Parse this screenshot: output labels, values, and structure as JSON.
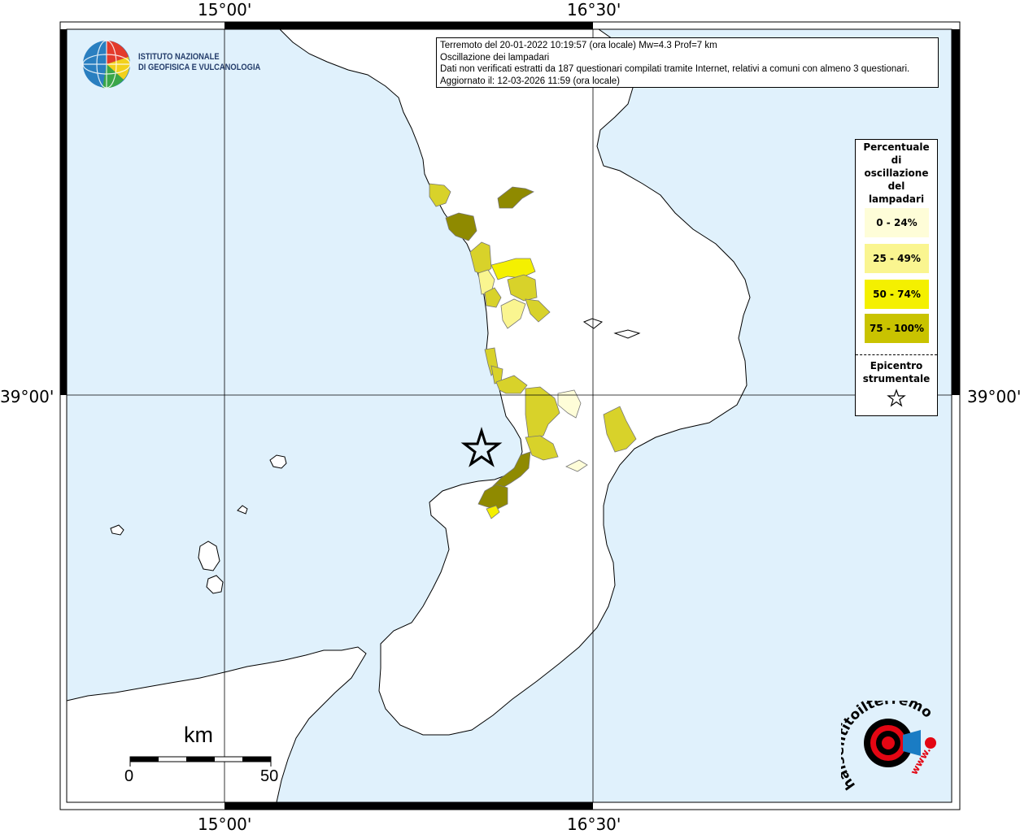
{
  "map": {
    "coords": {
      "lon_left": "15°00'",
      "lon_right": "16°30'",
      "lat": "39°00'"
    },
    "colors": {
      "sea": "#e0f1fc",
      "land": "#ffffff",
      "class_0_24": "#fefdd8",
      "class_25_49": "#faf590",
      "class_50_74": "#d8d22a",
      "class_75_100": "#8f8a00"
    }
  },
  "info": {
    "line1": "Terremoto del 20-01-2022 10:19:57 (ora locale) Mw=4.3 Prof=7 km",
    "line2": "Oscillazione dei lampadari",
    "line3": "Dati non verificati estratti da 187 questionari compilati tramite Internet, relativi a comuni con almeno 3 questionari.",
    "line4": "Aggiornato il: 12-03-2026 11:59 (ora locale)"
  },
  "legend": {
    "title": [
      "Percentuale",
      "di",
      "oscillazione",
      "del",
      "lampadari"
    ],
    "items": [
      {
        "label": "0 - 24%",
        "color": "#fefdd8"
      },
      {
        "label": "25 - 49%",
        "color": "#faf590"
      },
      {
        "label": "50 - 74%",
        "color": "#f4f000"
      },
      {
        "label": "75 - 100%",
        "color": "#c9c300"
      }
    ],
    "epicenter": [
      "Epicentro",
      "strumentale"
    ]
  },
  "logo": {
    "line1": "ISTITUTO NAZIONALE",
    "line2": "DI GEOFISICA E VULCANOLOGIA"
  },
  "scale": {
    "unit": "km",
    "min": "0",
    "max": "50"
  },
  "hsit": {
    "text1": "haisentitoilterremoto.it",
    "text2": "www."
  }
}
